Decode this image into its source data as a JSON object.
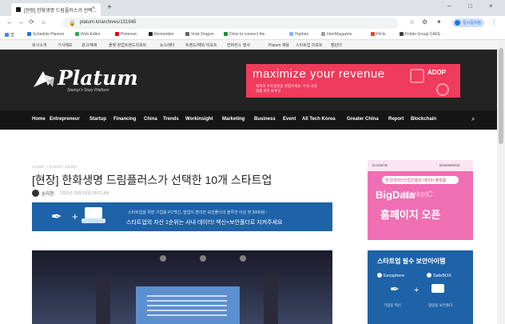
{
  "browser": {
    "tab_title": "[현장] 한화생명 드림플러스가 선택...",
    "tab_close": "×",
    "new_tab": "+",
    "url": "platum.kr/archives/131945",
    "profile_label": "일시중지됨",
    "window_controls": [
      "–",
      "□",
      "×"
    ],
    "bookmarks": [
      "앱",
      "Schedule Planner",
      "Web Editor",
      "Pinterest",
      "Remember",
      "Vosk Dragon",
      "Drive to connect the",
      "Hyphen",
      "InterMagazine",
      "Flickr",
      "Folder Group CAFE"
    ]
  },
  "site_strip": [
    "회사소개",
    "기사제보",
    "광고/제휴",
    "플랫 창업트렌드리포트",
    "뉴스레터",
    "트랜드/해외 리포트",
    "컨퍼런스 행사",
    "Platum 채용",
    "스타트업 리포트",
    "캘린더"
  ],
  "header": {
    "logo": "Platum",
    "tagline": "Startup's Story Platform",
    "ad_title": "maximize your revenue",
    "ad_sub": "최적의 수익실현을 경험하세요. 수익 극대화를 위한 솔루션",
    "ad_logo": "ADOP"
  },
  "nav": [
    "Home",
    "Entrepreneur",
    "Startup",
    "Financing",
    "China",
    "Trends",
    "Workinsight",
    "Marketing",
    "Business",
    "Event",
    "All Tech Korea",
    "Greater China",
    "Report",
    "Blockchain"
  ],
  "article": {
    "breadcrumb": "HOME > EVENT NEWS",
    "headline": "[현장] 한화생명 드림플러스가 선택한 10개 스타트업",
    "author": "손지현",
    "date": "2020년 03월 05일 08:52 AM",
    "banner_line1": "스타트업을 위한 기업용 PC백신, 협업이 편리한 보안폴더의 솔루션 이상 및 3000원~",
    "banner_line2": "스타트업의 자산 1순위는 사내 데이터! 백신+보안폴더로 지켜주세요"
  },
  "sidebar": {
    "ad1_logo_left": "kcontents",
    "ad1_logo_right": "kDataMarket",
    "ad1_tag": "한국데이터산업진흥원 데이터 플랫폼",
    "ad1_big": "BigData",
    "ad1_big2": "MarketC",
    "ad1_open": "홈페이지 오픈",
    "ad2_title": "스타트업 필수 보안아이템",
    "ad2_label1": "Exosphere",
    "ad2_label2": "SafeBOX",
    "ad2_caption1": "기업용 백신",
    "ad2_caption2": "협업용 보안폴더",
    "ad2_plus": "+"
  },
  "icons": {
    "search": "search-icon",
    "menu": "menu-icon"
  },
  "colors": {
    "header_bg": "#232323",
    "nav_bg": "#161616",
    "ad_pink": "#ef3b5c",
    "banner_blue": "#1e62a8",
    "side_pink": "#f06fb4"
  }
}
